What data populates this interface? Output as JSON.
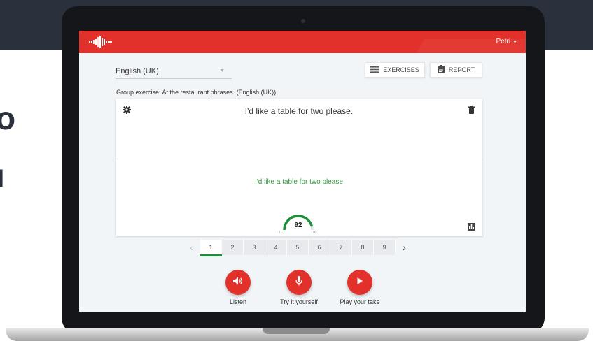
{
  "app": {
    "user": "Petri"
  },
  "language": {
    "selected": "English (UK)"
  },
  "toolbar": {
    "exercises_label": "EXERCISES",
    "report_label": "REPORT"
  },
  "exercise": {
    "group_title": "Group exercise: At the restaurant phrases. (English (UK))",
    "sentence": "I'd like a table for two please.",
    "recognized": "I'd like a table for two please",
    "score": "92",
    "score_value": 92,
    "score_min": "0",
    "score_max": "100"
  },
  "pager": {
    "pages": [
      "1",
      "2",
      "3",
      "4",
      "5",
      "6",
      "7",
      "8",
      "9"
    ],
    "active": 0,
    "prev": "‹",
    "next": "›"
  },
  "actions": {
    "listen": "Listen",
    "try": "Try it yourself",
    "play": "Play your take"
  },
  "colors": {
    "brand": "#e2302a",
    "success": "#2e9a3c",
    "pager_active": "#1d8f38",
    "background_band": "#2b313c"
  },
  "icons": {
    "logo": "soundwave-icon",
    "exercises": "list-icon",
    "report": "clipboard-icon",
    "settings": "gear-icon",
    "delete": "trash-icon",
    "stats": "bar-chart-icon",
    "listen": "speaker-icon",
    "try": "microphone-icon",
    "play": "play-icon"
  },
  "background_fragments": [
    "o",
    "ı"
  ]
}
